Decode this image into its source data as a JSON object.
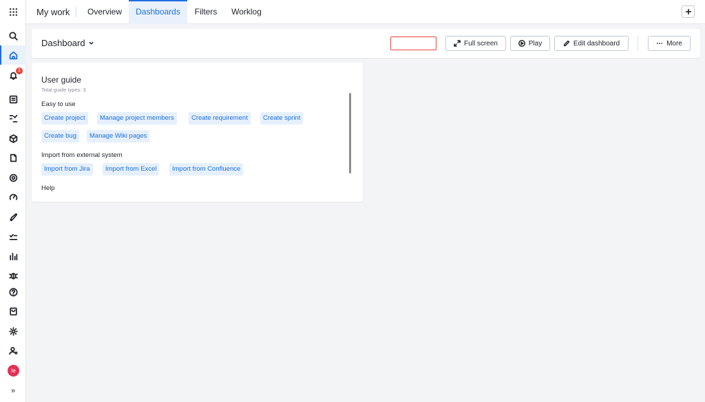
{
  "rail": {
    "icons": [
      "apps-grid-icon",
      "search-icon",
      "home-icon",
      "bell-icon",
      "book-icon",
      "list-check-icon",
      "cube-icon",
      "document-icon",
      "target-icon",
      "gauge-icon",
      "rocket-icon",
      "task-check-icon",
      "bar-chart-icon",
      "bug-icon",
      "help-icon",
      "store-icon",
      "gear-icon",
      "user-add-icon"
    ],
    "notification_count": "1",
    "avatar_initials": "te",
    "expand_glyph": "»"
  },
  "topbar": {
    "app_title": "My work",
    "tabs": [
      {
        "label": "Overview"
      },
      {
        "label": "Dashboards"
      },
      {
        "label": "Filters"
      },
      {
        "label": "Worklog"
      }
    ],
    "active_tab": "Dashboards"
  },
  "dashboard": {
    "title": "Dashboard",
    "buttons": {
      "fullscreen": "Full screen",
      "play": "Play",
      "edit": "Edit dashboard",
      "more": "More"
    }
  },
  "guide": {
    "title": "User guide",
    "subtitle": "Total guide types: 3",
    "sections": [
      {
        "title": "Easy to use",
        "items": [
          "Create project",
          "Manage project members",
          "Create requirement",
          "Create sprint",
          "Create bug",
          "Manage Wiki pages"
        ]
      },
      {
        "title": "Import from external system",
        "items": [
          "Import from Jira",
          "Import from Excel",
          "Import from Confluence"
        ]
      },
      {
        "title": "Help",
        "items": []
      }
    ]
  },
  "colors": {
    "accent": "#1d6fe0",
    "accent_bg": "#e9f1fd",
    "chip_bg": "#e6f0fd",
    "badge": "#e8473e",
    "avatar": "#e23056",
    "page_bg": "#f3f4f6"
  }
}
